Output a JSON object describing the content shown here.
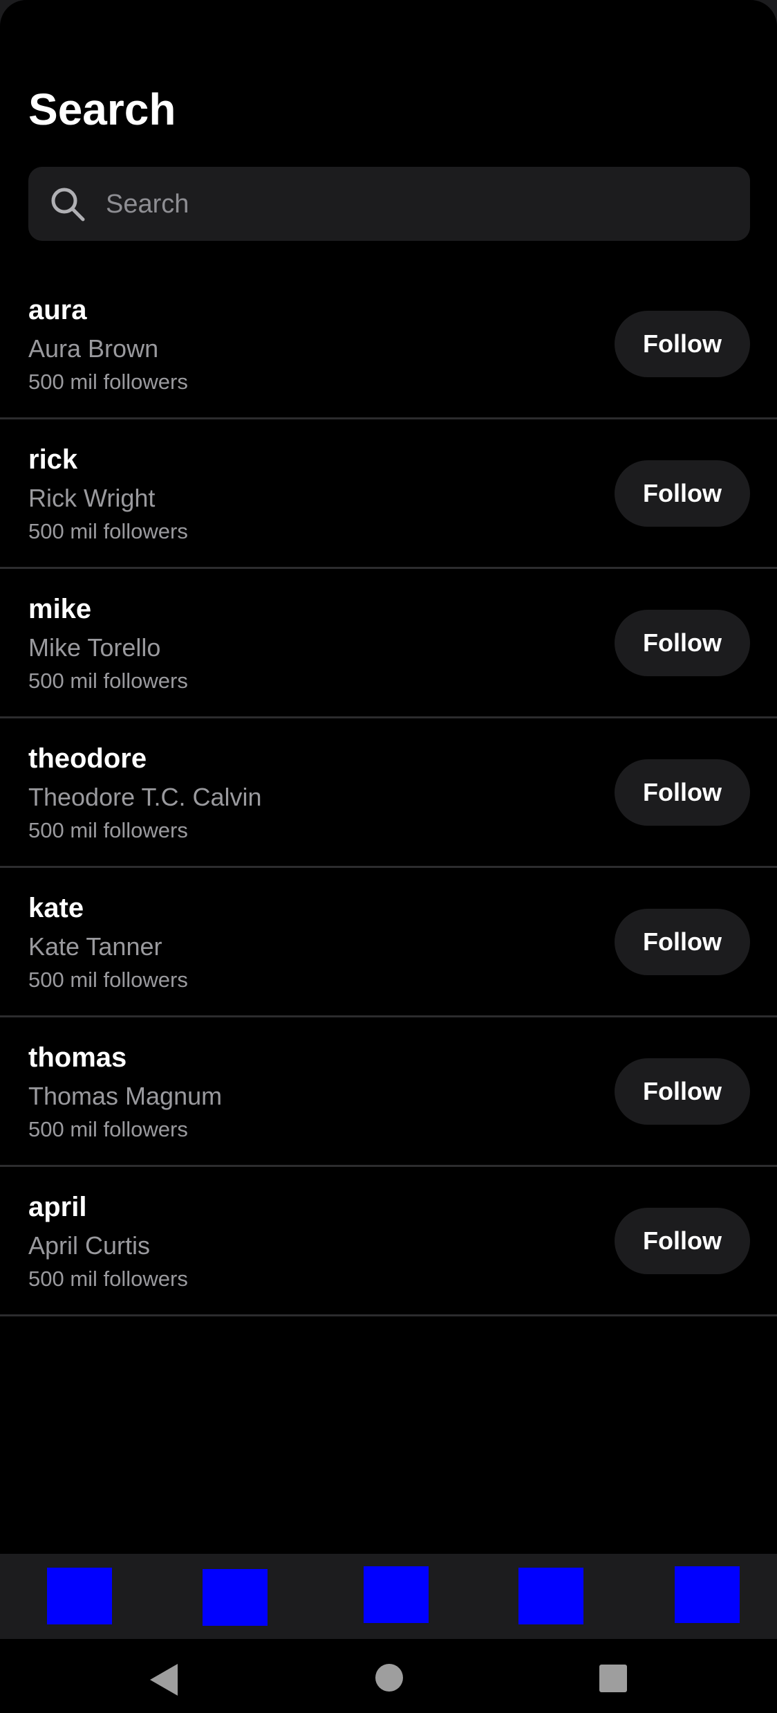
{
  "page": {
    "title": "Search"
  },
  "search": {
    "placeholder": "Search",
    "value": ""
  },
  "users": [
    {
      "username": "aura",
      "name": "Aura Brown",
      "followers": "500 mil followers",
      "button": "Follow"
    },
    {
      "username": "rick",
      "name": "Rick Wright",
      "followers": "500 mil followers",
      "button": "Follow"
    },
    {
      "username": "mike",
      "name": "Mike Torello",
      "followers": "500 mil followers",
      "button": "Follow"
    },
    {
      "username": "theodore",
      "name": "Theodore T.C. Calvin",
      "followers": "500 mil followers",
      "button": "Follow"
    },
    {
      "username": "kate",
      "name": "Kate Tanner",
      "followers": "500 mil followers",
      "button": "Follow"
    },
    {
      "username": "thomas",
      "name": "Thomas Magnum",
      "followers": "500 mil followers",
      "button": "Follow"
    },
    {
      "username": "april",
      "name": "April Curtis",
      "followers": "500 mil followers",
      "button": "Follow"
    }
  ],
  "tab_bar": {
    "tab_count": 5,
    "tab_color": "#0000ff"
  },
  "system_nav": {
    "buttons": [
      "back-icon",
      "home-icon",
      "recents-icon"
    ],
    "color": "#9e9e9e"
  },
  "colors": {
    "background": "#000000",
    "surface": "#1c1c1e",
    "text": "#ffffff",
    "muted_text": "#9a9a9e",
    "divider": "#2c2c2e"
  }
}
